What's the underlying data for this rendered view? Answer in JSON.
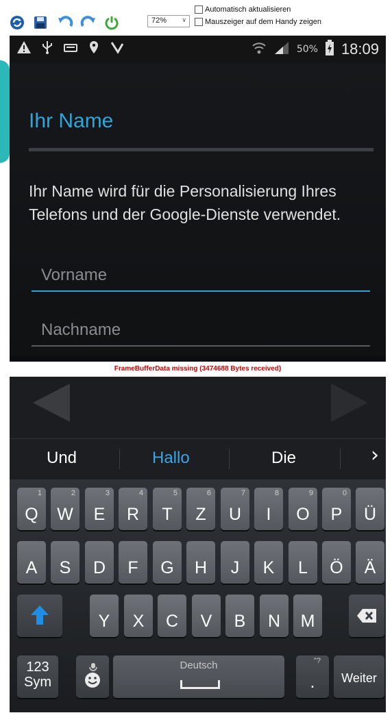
{
  "toolbar": {
    "icons": [
      "refresh-icon",
      "save-icon",
      "rotate-left-icon",
      "rotate-right-icon",
      "power-icon"
    ],
    "zoom_value": "72%",
    "auto_update_label": "Automatisch aktualisieren",
    "show_pointer_label": "Mauszeiger auf dem Handy zeigen"
  },
  "status_bar": {
    "battery_percent": "50%",
    "time": "18:09"
  },
  "screen": {
    "title": "Ihr Name",
    "description": "Ihr Name wird für die Personalisierung Ihres Telefons und der Google-Dienste verwendet.",
    "first_name_placeholder": "Vorname",
    "last_name_placeholder": "Nachname"
  },
  "error_message": "FrameBufferData missing (3474688 Bytes received)",
  "suggestions": [
    "Und",
    "Hallo",
    "Die"
  ],
  "keyboard": {
    "row1": [
      {
        "key": "Q",
        "hint": "1"
      },
      {
        "key": "W",
        "hint": "2"
      },
      {
        "key": "E",
        "hint": "3"
      },
      {
        "key": "R",
        "hint": "4"
      },
      {
        "key": "T",
        "hint": "5"
      },
      {
        "key": "Z",
        "hint": "6"
      },
      {
        "key": "U",
        "hint": "7"
      },
      {
        "key": "I",
        "hint": "8"
      },
      {
        "key": "O",
        "hint": "9"
      },
      {
        "key": "P",
        "hint": "0"
      },
      {
        "key": "Ü",
        "hint": ""
      }
    ],
    "row2": [
      "A",
      "S",
      "D",
      "F",
      "G",
      "H",
      "J",
      "K",
      "L",
      "Ö",
      "Ä"
    ],
    "row3": [
      "Y",
      "X",
      "C",
      "V",
      "B",
      "N",
      "M"
    ],
    "sym_top": "123",
    "sym_bottom": "Sym",
    "space_label": "Deutsch",
    "enter_label": "Weiter",
    "period_label": ".",
    "period_hint": "\"?"
  },
  "colors": {
    "accent": "#2fa5d8",
    "error_text": "#cc0000",
    "phone_background": "#0b0d10"
  }
}
